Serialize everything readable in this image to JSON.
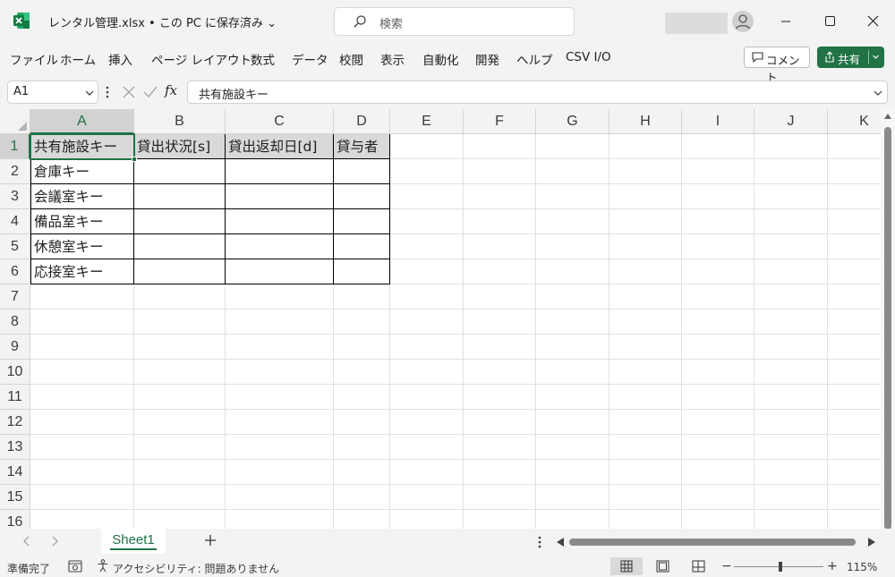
{
  "titlebar": {
    "doc_title": "レンタル管理.xlsx • この PC に保存済み ⌄",
    "search_placeholder": "検索"
  },
  "menu": [
    "ファイル",
    "ホーム",
    "挿入",
    "ページ レイアウト",
    "数式",
    "データ",
    "校閲",
    "表示",
    "自動化",
    "開発",
    "ヘルプ",
    "CSV I/O"
  ],
  "actions": {
    "comment": "コメント",
    "share": "共有"
  },
  "formula_bar": {
    "name_box": "A1",
    "fx": "fx",
    "formula": "共有施設キー"
  },
  "grid": {
    "columns": [
      "A",
      "B",
      "C",
      "D",
      "E",
      "F",
      "G",
      "H",
      "I",
      "J",
      "K"
    ],
    "rows": [
      "1",
      "2",
      "3",
      "4",
      "5",
      "6",
      "7",
      "8",
      "9",
      "10",
      "11",
      "12",
      "13",
      "14",
      "15",
      "16"
    ],
    "table_header": [
      "共有施設キー",
      "貸出状況[s]",
      "貸出返却日[d]",
      "貸与者"
    ],
    "table_rows": [
      [
        "倉庫キー",
        "",
        "",
        ""
      ],
      [
        "会議室キー",
        "",
        "",
        ""
      ],
      [
        "備品室キー",
        "",
        "",
        ""
      ],
      [
        "休憩室キー",
        "",
        "",
        ""
      ],
      [
        "応接室キー",
        "",
        "",
        ""
      ]
    ],
    "selected_cell": "A1"
  },
  "sheets": {
    "active": "Sheet1",
    "add": "+"
  },
  "status": {
    "ready": "準備完了",
    "accessibility": "アクセシビリティ: 問題ありません",
    "zoom_minus": "−",
    "zoom_plus": "+",
    "zoom": "115%",
    "zoom_level": 1.15
  },
  "colors": {
    "accent": "#217346",
    "header_fill": "#d9d9d9"
  }
}
